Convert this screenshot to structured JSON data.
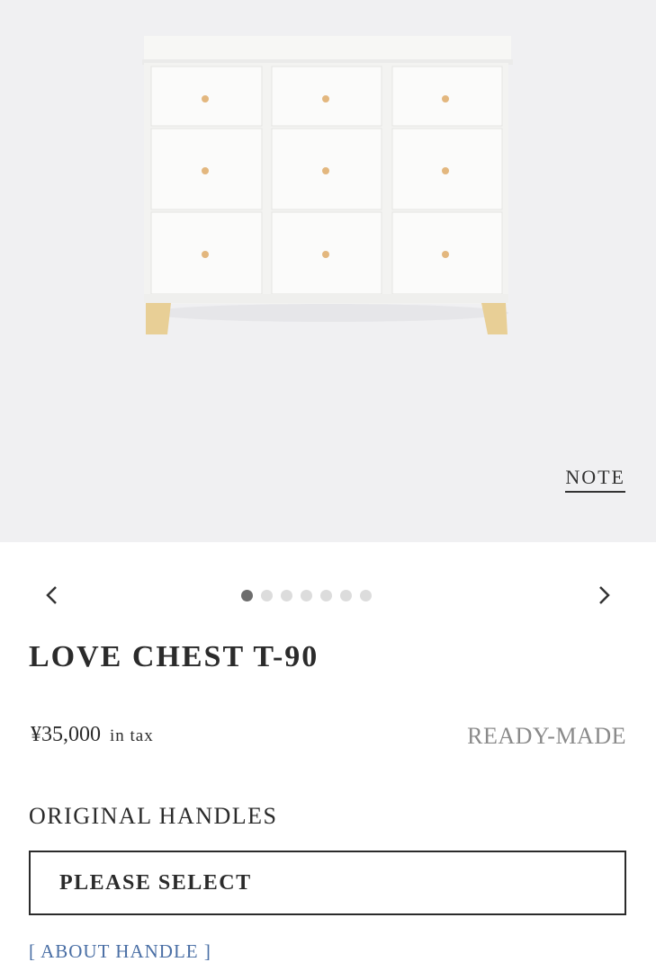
{
  "hero": {
    "note_label": "NOTE",
    "image_alt": "LOVE CHEST T-90",
    "colors": {
      "background": "#f0f0f2",
      "chest_body": "#f9f9f7",
      "knob": "#e3b77e",
      "legs": "#e8cf96"
    }
  },
  "carousel": {
    "prev_icon": "chevron-left-icon",
    "next_icon": "chevron-right-icon",
    "dot_count": 7,
    "active_index": 0
  },
  "product": {
    "title": "LOVE CHEST T-90",
    "price": "¥35,000",
    "price_unit": "in tax",
    "type_label": "READY-MADE"
  },
  "handles": {
    "label": "ORIGINAL HANDLES",
    "select_value": "PLEASE SELECT",
    "about_link": "[ ABOUT HANDLE ]"
  },
  "accent": {
    "link": "#4a6fa5",
    "active_dot": "#6d6d6d",
    "inactive_dot": "#dcdcdc"
  }
}
